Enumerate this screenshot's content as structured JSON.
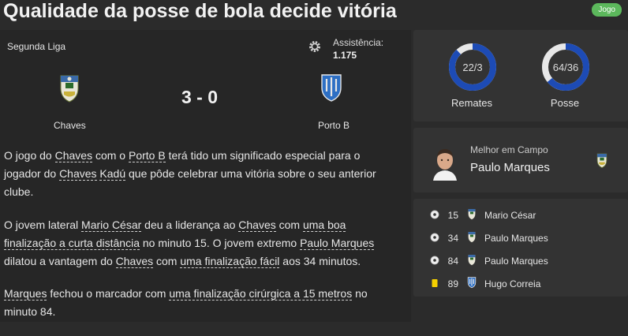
{
  "header": {
    "title": "Qualidade da posse de bola decide vitória",
    "badge": "Jogo"
  },
  "match": {
    "competition": "Segunda Liga",
    "attendance_label": "Assistência:",
    "attendance_value": "1.175",
    "score": "3 - 0",
    "home_team": "Chaves",
    "away_team": "Porto B"
  },
  "report": {
    "p1": [
      {
        "t": "O jogo do "
      },
      {
        "t": "Chaves",
        "u": true
      },
      {
        "t": " com o "
      },
      {
        "t": "Porto B",
        "u": true
      },
      {
        "t": " terá tido um significado especial para o jogador do "
      },
      {
        "t": "Chaves",
        "u": true
      },
      {
        "t": " "
      },
      {
        "t": "Kadú",
        "u": true
      },
      {
        "t": " que pôde celebrar uma vitória sobre o seu anterior clube."
      }
    ],
    "p2": [
      {
        "t": "O jovem lateral "
      },
      {
        "t": "Mario César",
        "u": true
      },
      {
        "t": " deu a liderança ao "
      },
      {
        "t": "Chaves",
        "u": true
      },
      {
        "t": " com "
      },
      {
        "t": "uma boa finalização a curta distância",
        "u": true
      },
      {
        "t": " no minuto 15. O jovem extremo "
      },
      {
        "t": "Paulo Marques",
        "u": true
      },
      {
        "t": " dilatou a vantagem do "
      },
      {
        "t": "Chaves",
        "u": true
      },
      {
        "t": " com "
      },
      {
        "t": "uma finalização fácil",
        "u": true
      },
      {
        "t": " aos 34 minutos."
      }
    ],
    "p3": [
      {
        "t": "Marques",
        "u": true
      },
      {
        "t": " fechou o marcador com "
      },
      {
        "t": "uma finalização cirúrgica a 15 metros",
        "u": true
      },
      {
        "t": " no minuto 84."
      }
    ]
  },
  "stats": {
    "shots_value": "22/3",
    "shots_label": "Remates",
    "shots_fraction": 0.88,
    "possession_value": "64/36",
    "possession_label": "Posse",
    "possession_fraction": 0.64
  },
  "motm": {
    "label": "Melhor em Campo",
    "name": "Paulo Marques"
  },
  "events": [
    {
      "type": "goal",
      "minute": "15",
      "player": "Mario César",
      "team": "Chaves"
    },
    {
      "type": "goal",
      "minute": "34",
      "player": "Paulo Marques",
      "team": "Chaves"
    },
    {
      "type": "goal",
      "minute": "84",
      "player": "Paulo Marques",
      "team": "Chaves"
    },
    {
      "type": "yellow-card",
      "minute": "89",
      "player": "Hugo Correia",
      "team": "Porto B"
    }
  ],
  "colors": {
    "accent_blue": "#1d4bb5",
    "ring_track": "#e8e8e8",
    "badge_green": "#5cb85c",
    "yellow_card": "#f5d000"
  }
}
